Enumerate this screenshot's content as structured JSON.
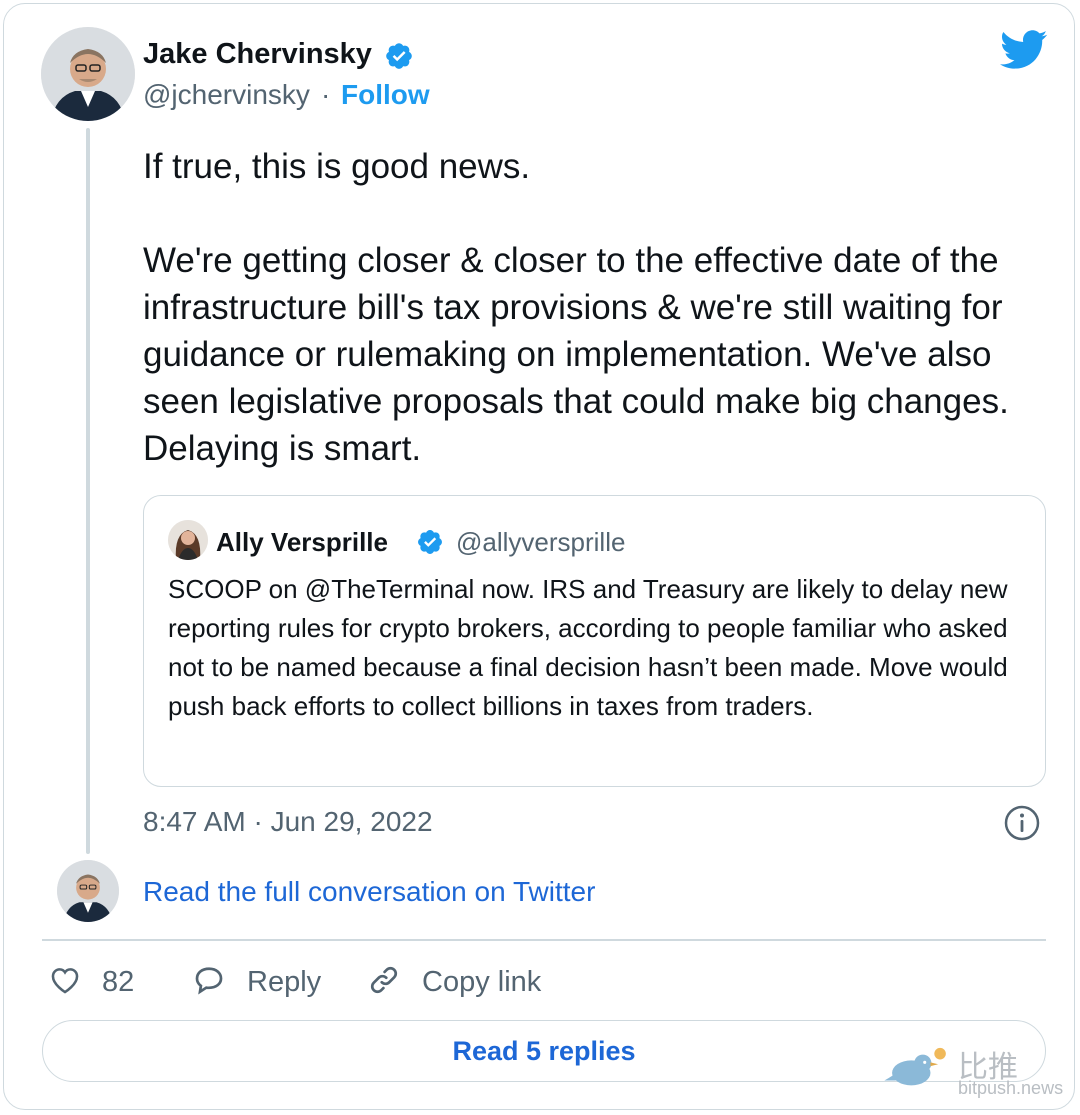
{
  "author": {
    "name": "Jake Chervinsky",
    "handle": "@jchervinsky",
    "separator": "·",
    "follow_label": "Follow"
  },
  "tweet": {
    "text": "If true, this is good news.\n\nWe're getting closer & closer to the effective date of the infrastructure bill's tax provisions & we're still waiting for guidance or rulemaking on implementation. We've also seen legislative proposals that could make big changes. Delaying is smart.",
    "timestamp": "8:47 AM · Jun 29, 2022"
  },
  "quoted_tweet": {
    "name": "Ally Versprille",
    "handle": "@allyversprille",
    "text": "SCOOP on @TheTerminal now. IRS and Treasury are likely to delay new reporting rules for crypto brokers, according to people familiar who asked not to be named because a final decision hasn’t been made. Move would push back efforts to collect billions in taxes from traders."
  },
  "conversation_link": "Read the full conversation on Twitter",
  "actions": {
    "like_count": "82",
    "reply_label": "Reply",
    "copy_link_label": "Copy link"
  },
  "read_replies_label": "Read 5 replies",
  "watermark": {
    "chinese": "比推",
    "site": "bitpush.news"
  },
  "colors": {
    "link_blue": "#1d67d6",
    "twitter_blue": "#1d9bf0",
    "secondary_text": "#536471",
    "border": "#cfd9de"
  },
  "icons": [
    "twitter-bird-icon",
    "verified-badge-icon",
    "info-icon",
    "heart-icon",
    "reply-bubble-icon",
    "link-icon"
  ]
}
